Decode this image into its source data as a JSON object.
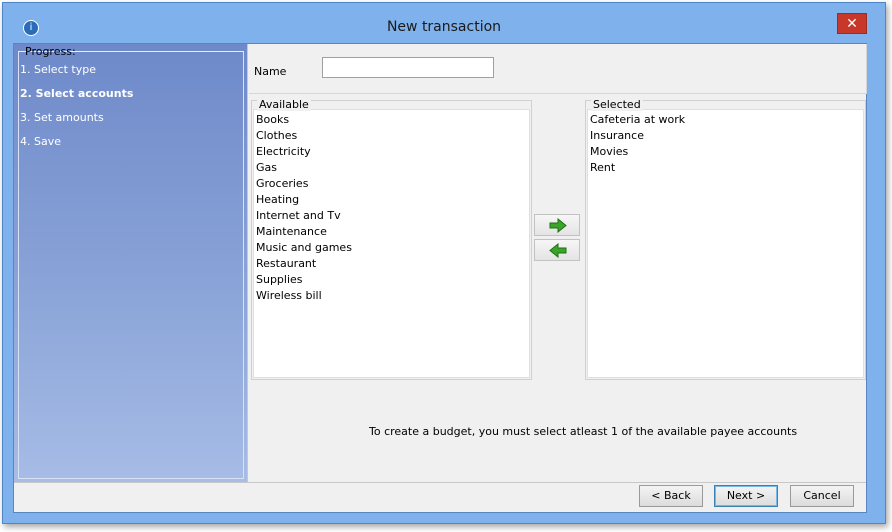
{
  "window": {
    "title": "New transaction",
    "close_glyph": "✕",
    "app_icon": "app-icon"
  },
  "progress": {
    "legend": "Progress:",
    "steps": [
      {
        "label": "1. Select type",
        "active": false
      },
      {
        "label": "2. Select accounts",
        "active": true
      },
      {
        "label": "3. Set amounts",
        "active": false
      },
      {
        "label": "4. Save",
        "active": false
      }
    ]
  },
  "form": {
    "name_label": "Name",
    "name_value": ""
  },
  "available": {
    "label": "Available",
    "items": [
      "Books",
      "Clothes",
      "Electricity",
      "Gas",
      "Groceries",
      "Heating",
      "Internet and Tv",
      "Maintenance",
      "Music and games",
      "Restaurant",
      "Supplies",
      "Wireless bill"
    ]
  },
  "selected": {
    "label": "Selected",
    "items": [
      "Cafeteria at work",
      "Insurance",
      "Movies",
      "Rent"
    ]
  },
  "arrows": {
    "add_icon": "arrow-right-icon",
    "remove_icon": "arrow-left-icon",
    "color": "#3aa629"
  },
  "hint": "To create a budget, you must select atleast 1 of the available payee accounts",
  "buttons": {
    "back": "< Back",
    "next": "Next >",
    "cancel": "Cancel"
  }
}
